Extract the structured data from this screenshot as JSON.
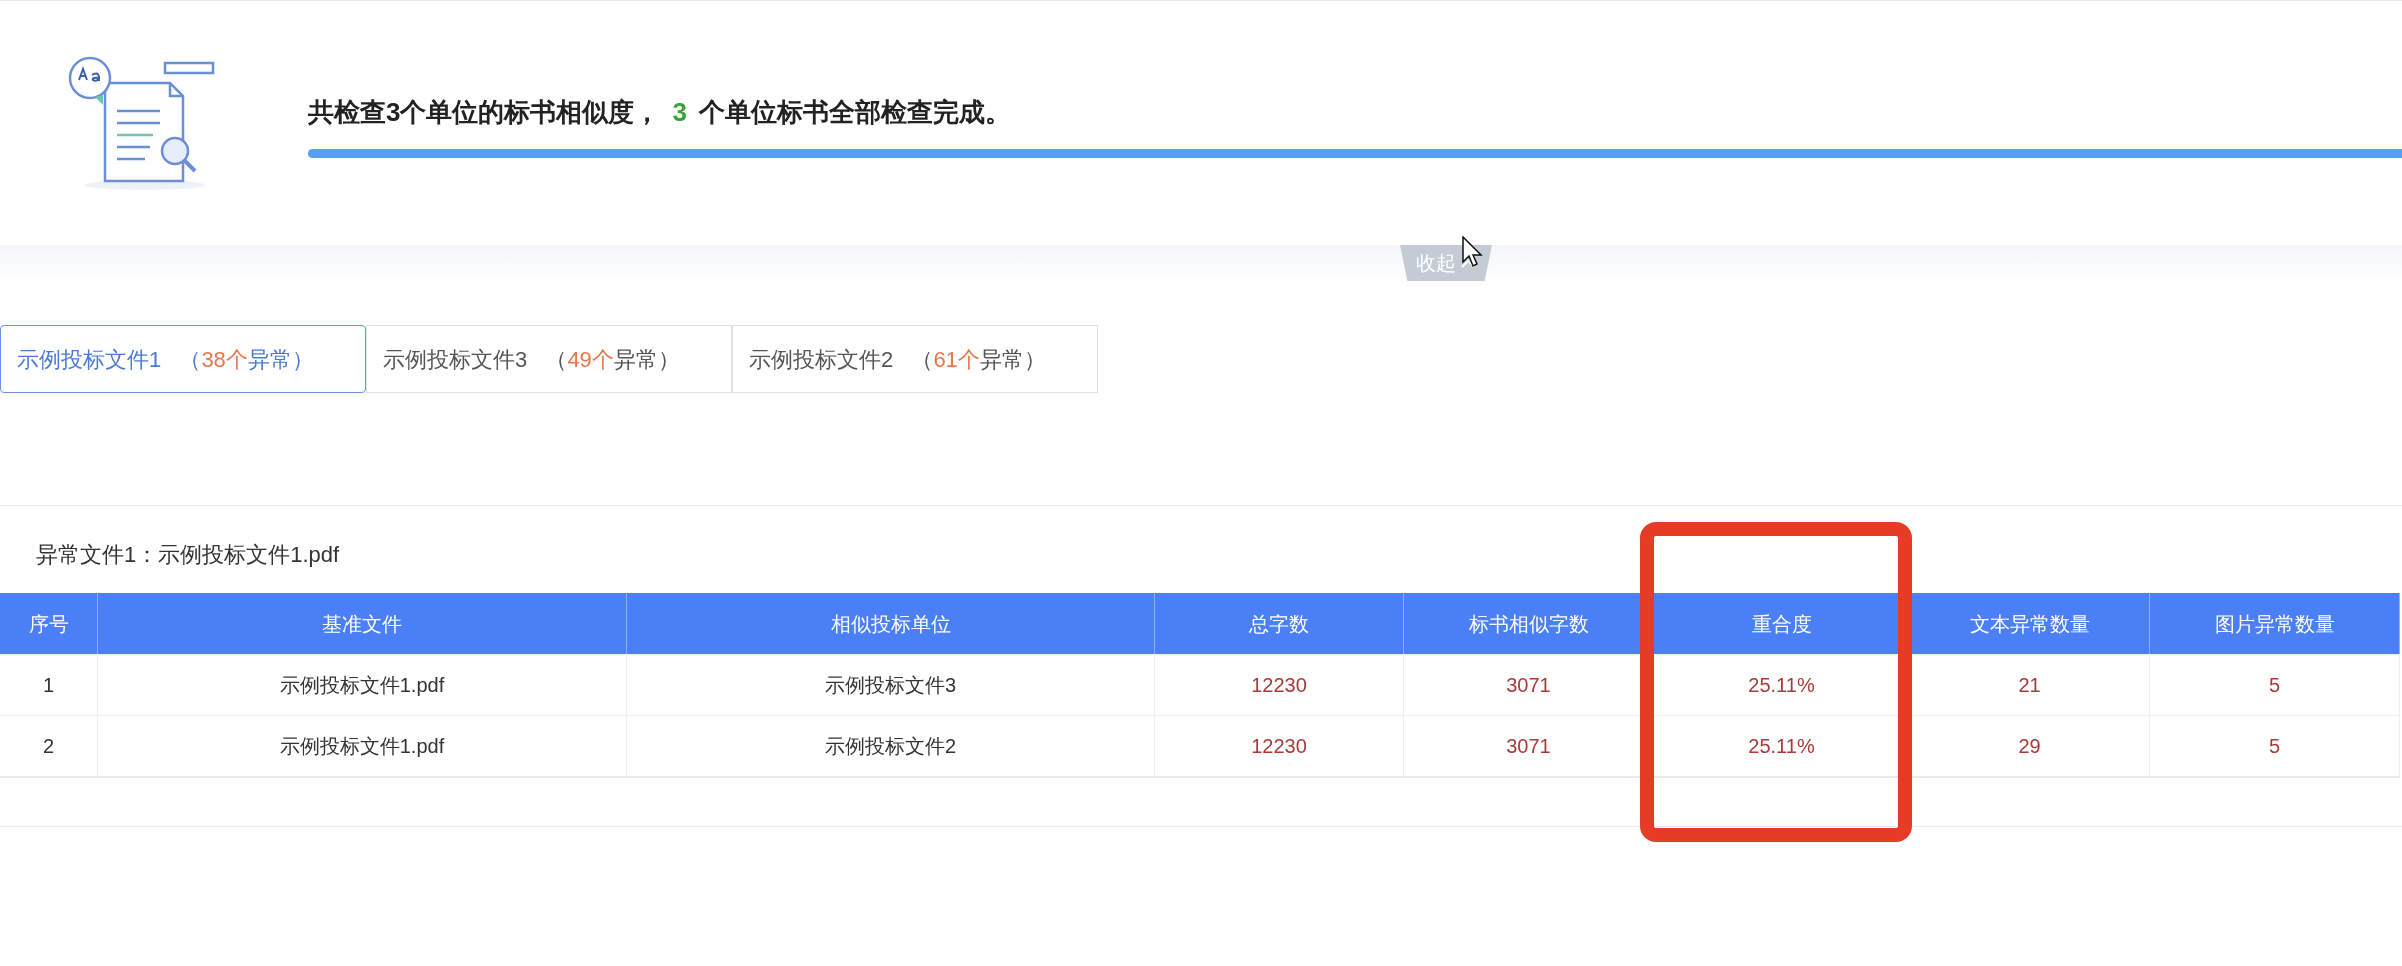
{
  "summary": {
    "prefix": "共检查3个单位的标书相似度，",
    "count": "3",
    "suffix": "个单位标书全部检查完成。",
    "level": 1.0
  },
  "collapse": {
    "label": "收起"
  },
  "tabs": [
    {
      "label": "示例投标文件1",
      "open": "（",
      "count": "38个",
      "close": "异常）",
      "selected": true
    },
    {
      "label": "示例投标文件3",
      "open": "（",
      "count": "49个",
      "close": "异常）",
      "selected": false
    },
    {
      "label": "示例投标文件2",
      "open": "（",
      "count": "61个",
      "close": "异常）",
      "selected": false
    }
  ],
  "section_title": "异常文件1：示例投标文件1.pdf",
  "table": {
    "columns": [
      "序号",
      "基准文件",
      "相似投标单位",
      "总字数",
      "标书相似字数",
      "重合度",
      "文本异常数量",
      "图片异常数量"
    ],
    "rows": [
      [
        "1",
        "示例投标文件1.pdf",
        "示例投标文件3",
        "12230",
        "3071",
        "25.11%",
        "21",
        "5"
      ],
      [
        "2",
        "示例投标文件1.pdf",
        "示例投标文件2",
        "12230",
        "3071",
        "25.11%",
        "29",
        "5"
      ]
    ]
  }
}
